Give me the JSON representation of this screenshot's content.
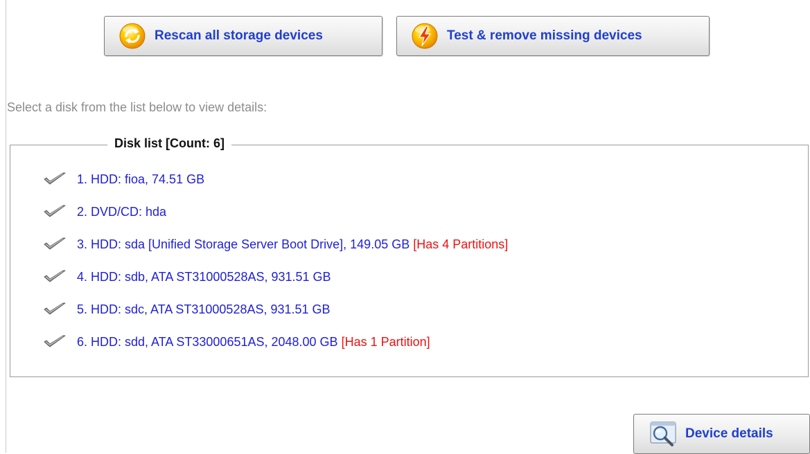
{
  "toolbar": {
    "rescan_label": "Rescan all storage devices",
    "rescan_icon": "refresh-orb-icon",
    "test_label": "Test & remove missing devices",
    "test_icon": "lightning-orb-icon"
  },
  "instruction": "Select a disk from the list below to view details:",
  "disk_list": {
    "title": "Disk list [Count: 6]",
    "items": [
      {
        "label": "1. HDD: fioa, 74.51 GB",
        "note": ""
      },
      {
        "label": "2. DVD/CD: hda",
        "note": ""
      },
      {
        "label": "3. HDD: sda [Unified Storage Server Boot Drive], 149.05 GB",
        "note": "[Has 4 Partitions]"
      },
      {
        "label": "4. HDD: sdb, ATA ST31000528AS, 931.51 GB",
        "note": ""
      },
      {
        "label": "5. HDD: sdc, ATA ST31000528AS, 931.51 GB",
        "note": ""
      },
      {
        "label": "6. HDD: sdd, ATA ST33000651AS, 2048.00 GB",
        "note": "[Has 1 Partition]"
      }
    ]
  },
  "details_button": {
    "label": "Device details",
    "icon": "magnifier-icon"
  },
  "colors": {
    "link_blue": "#1f1fd8",
    "button_text_blue": "#1f3fd0",
    "note_red": "#ee1111",
    "instruction_gray": "#8c8c8c"
  }
}
